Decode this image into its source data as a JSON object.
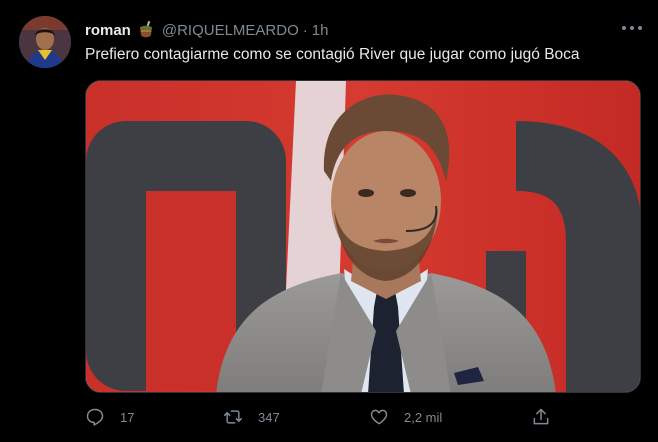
{
  "tweet": {
    "author": {
      "display_name": "roman",
      "handle": "@RIQUELMEARDO",
      "emoji_icon": "mate-cup-icon",
      "avatar_icon": "profile-avatar"
    },
    "separator": "·",
    "time": "1h",
    "text": "Prefiero contagiarme como se contagió River que jugar como jugó Boca",
    "media": {
      "icon": "tv-presenter-photo"
    },
    "actions": {
      "reply": {
        "icon": "reply-icon",
        "count": "17"
      },
      "retweet": {
        "icon": "retweet-icon",
        "count": "347"
      },
      "like": {
        "icon": "heart-icon",
        "count": "2,2 mil"
      },
      "share": {
        "icon": "share-icon"
      }
    },
    "more_icon": "more-options-icon"
  },
  "colors": {
    "background": "#000000",
    "primary_text": "#e7e9ea",
    "secondary_text": "#7f8a94",
    "border": "#2f3336"
  }
}
